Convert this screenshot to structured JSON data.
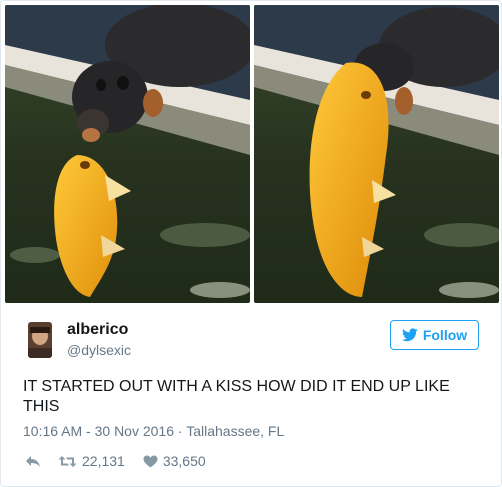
{
  "tweet": {
    "display_name": "alberico",
    "handle": "@dylsexic",
    "text": "IT STARTED OUT WITH A KISS HOW DID IT END UP LIKE THIS",
    "time": "10:16 AM",
    "date": "30 Nov 2016",
    "location": "Tallahassee, FL",
    "retweets": "22,131",
    "likes": "33,650"
  },
  "follow_button": {
    "label": "Follow"
  },
  "meta_separators": {
    "dash": " - ",
    "dot": " · "
  },
  "colors": {
    "accent": "#1da1f2",
    "text_primary": "#14171a",
    "text_secondary": "#657786",
    "border": "#e1e8ed",
    "fish": "#f0a915"
  },
  "icons": {
    "follow": "twitter-bird-icon",
    "reply": "reply-arrow-icon",
    "retweet": "retweet-icon",
    "like": "heart-icon"
  }
}
